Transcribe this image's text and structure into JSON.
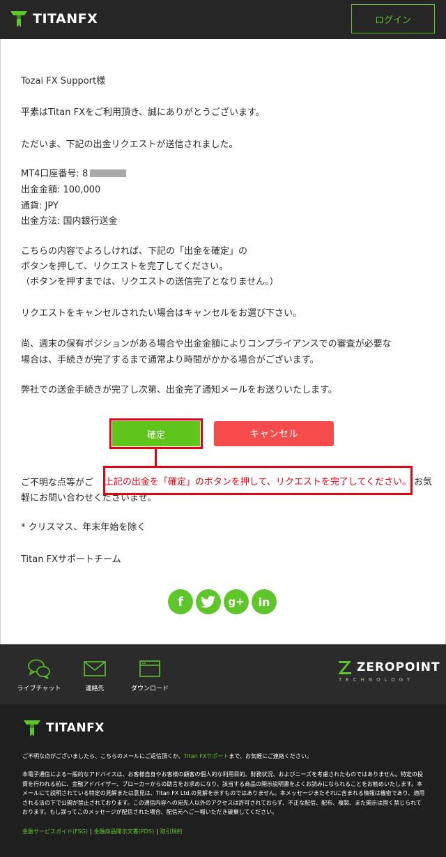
{
  "header": {
    "brand": "TITANFX",
    "login_label": "ログイン"
  },
  "body": {
    "greeting": "Tozai FX Support様",
    "line1": "平素はTitan FXをご利用頂き、誠にありがとうございます。",
    "line2": "ただいま、下記の出金リクエストが送信されました。",
    "account_label": "MT4口座番号: 8",
    "amount": "出金金額: 100,000",
    "currency": "通貨: JPY",
    "method": "出金方法: 国内銀行送金",
    "instr1": "こちらの内容でよろしければ、下記の「出金を確定」の",
    "instr2": "ボタンを押して、リクエストを完了してください。",
    "instr3": "（ボタンを押すまでは、リクエストの送信完了となりません。）",
    "cancel_note": "リクエストをキャンセルされたい場合はキャンセルをお選び下さい。",
    "compliance1": "尚、週末の保有ポジションがある場合や出金金額によりコンプライアンスでの審査が必要な",
    "compliance2": "場合は、手続きが完了するまで通常より時間がかかる場合がございます。",
    "completion": "弊社での送金手続きが完了し次第、出金完了通知メールをお送りいたします。",
    "inquiry1": "ご不明な点等がご",
    "inquiry1_suffix": "お気",
    "inquiry2": "軽にお問い合わせくださいませ。",
    "holidays": "* クリスマス、年末年始を除く",
    "signature": "Titan FXサポートチーム"
  },
  "buttons": {
    "confirm": "確定",
    "cancel": "キャンセル"
  },
  "callout": "上記の出金を「確定」のボタンを押して、リクエストを完了してください。",
  "social": [
    "f",
    "t",
    "g+",
    "in"
  ],
  "footer": {
    "items": [
      "ライブチャット",
      "連絡先",
      "ダウンロード"
    ],
    "zeropoint": "ZEROPOINT",
    "technology": "TECHNOLOGY",
    "brand": "TITANFX",
    "note_pre": "ご不明な点がございましたら、こちらのメールにご返信頂くか、",
    "note_link": "Titan FXサポート",
    "note_post": "まで、お気軽にご連絡ください。",
    "disclaimer": "本電子通信による一般的なアドバイスは、お客様自身やお客様の顧客の個人的な利用目的、財務状況、およびニーズを考慮されたものではありません。特定の投資を行われる前に、金融アドバイザー、ブローカーからの助言をお求めになり、該当する商品の開示説明書をよくお読みになられることをお勧めいたします。本メールにて説明されている特定の見解または意見は、Titan FX Ltd.の見解を示すものではありません。本メッセージまたそれに含まれる情報は機密であり、適用される法の下で公開が禁止されております。この通信内容への宛先人以外のアクセスは許可されておらず、不正な配信、配布、複製、また開示は固く禁じられております。もし誤ってこのメッセージが配信された場合、配信元へご一報いただき破棄してください。",
    "links": [
      "金融サービスガイド(FSG)",
      "金融商品開示文書(PDS)",
      "取引規約"
    ]
  }
}
